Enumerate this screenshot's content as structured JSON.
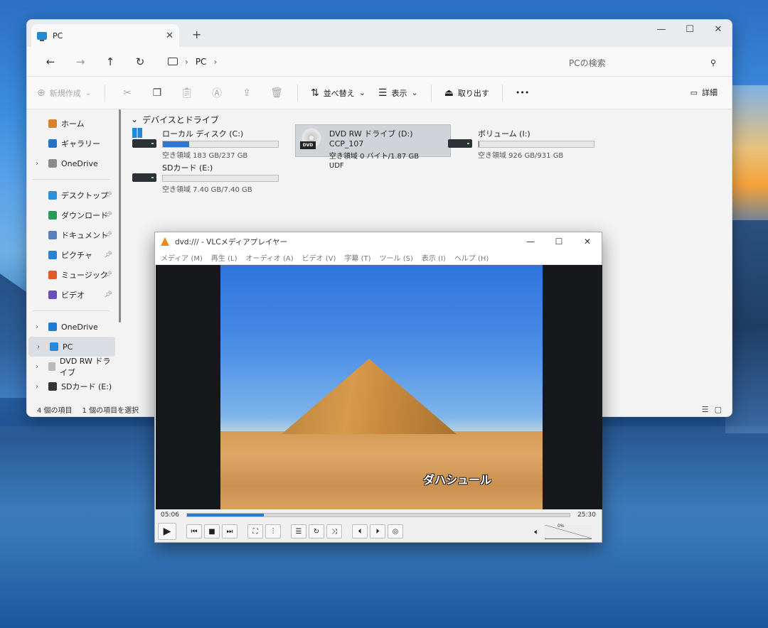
{
  "explorer": {
    "tab_title": "PC",
    "new_tab": "+",
    "window_controls": [
      "—",
      "☐",
      "✕"
    ],
    "nav": {
      "back": "←",
      "forward": "→",
      "up": "↑",
      "refresh": "↻"
    },
    "breadcrumb": [
      "PC"
    ],
    "search_placeholder": "PCの検索",
    "commands": {
      "new": "新規作成",
      "sort": "並べ替え",
      "view": "表示",
      "eject": "取り出す",
      "more": "•••",
      "details": "詳細"
    },
    "sidebar": {
      "quick": [
        {
          "label": "ホーム",
          "icon": "home-icon",
          "color": "#d9812b"
        },
        {
          "label": "ギャラリー",
          "icon": "gallery-icon",
          "color": "#2a6fc8"
        },
        {
          "label": "OneDrive",
          "icon": "file-icon",
          "color": "#8a8a8a"
        }
      ],
      "pinned": [
        {
          "label": "デスクトップ",
          "icon": "desktop-icon",
          "color": "#2f8ed8"
        },
        {
          "label": "ダウンロード",
          "icon": "download-icon",
          "color": "#2a9a57"
        },
        {
          "label": "ドキュメント",
          "icon": "document-icon",
          "color": "#5b7fb8"
        },
        {
          "label": "ピクチャ",
          "icon": "pictures-icon",
          "color": "#2a82d0"
        },
        {
          "label": "ミュージック",
          "icon": "music-icon",
          "color": "#e05a2a"
        },
        {
          "label": "ビデオ",
          "icon": "video-icon",
          "color": "#6a4fb8"
        }
      ],
      "tree": [
        {
          "label": "OneDrive",
          "icon": "cloud-icon",
          "color": "#1f7ad6"
        },
        {
          "label": "PC",
          "icon": "pc-icon",
          "color": "#2a8ad8"
        },
        {
          "label": "DVD RW ドライブ",
          "icon": "disc-icon",
          "color": "#b9b9b9"
        },
        {
          "label": "SDカード (E:)",
          "icon": "drive-icon",
          "color": "#333333"
        }
      ]
    },
    "group_title": "デバイスとドライブ",
    "drives": [
      {
        "name": "ローカル ディスク (C:)",
        "free": "空き領域 183 GB/237 GB",
        "used_fraction": 0.23
      },
      {
        "name": "DVD RW ドライブ (D:) CCP_107",
        "free": "空き領域 0 バイト/1.87 GB",
        "fs": "UDF",
        "badge": "DVD"
      },
      {
        "name": "ボリューム (I:)",
        "free": "空き領域 926 GB/931 GB",
        "used_fraction": 0.005
      },
      {
        "name": "SDカード (E:)",
        "free": "空き領域 7.40 GB/7.40 GB",
        "used_fraction": 0.0
      }
    ],
    "status": {
      "count": "4 個の項目",
      "selected": "1 個の項目を選択"
    }
  },
  "vlc": {
    "title": "dvd:/// - VLCメディアプレイヤー",
    "window_controls": [
      "—",
      "☐",
      "✕"
    ],
    "menu": [
      "メディア (M)",
      "再生 (L)",
      "オーディオ (A)",
      "ビデオ (V)",
      "字幕 (T)",
      "ツール (S)",
      "表示 (I)",
      "ヘルプ (H)"
    ],
    "subtitle": "ダハシュール",
    "elapsed": "05:06",
    "total": "25:30",
    "progress": 0.2,
    "volume": "0%"
  }
}
